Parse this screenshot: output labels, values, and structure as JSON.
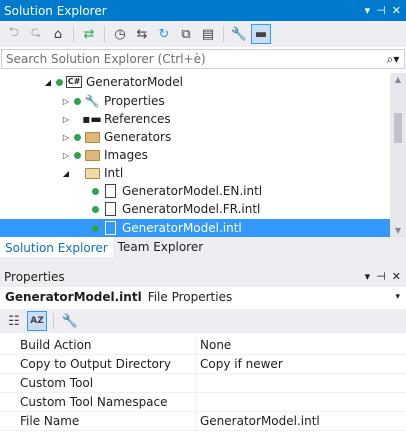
{
  "solution_explorer": {
    "title": "Solution Explorer",
    "title_buttons": [
      "▾",
      "⊣",
      "✕"
    ],
    "toolbar_icons": [
      "back-icon",
      "forward-icon",
      "home-icon",
      "sync-icon",
      "history-icon",
      "switch-views-icon",
      "refresh-icon",
      "collapse-all-icon",
      "show-all-files-icon",
      "properties-icon",
      "preview-icon"
    ],
    "search": {
      "placeholder": "Search Solution Explorer (Ctrl+è)",
      "dropdown": "⌕▾"
    },
    "tree": [
      {
        "label": "GeneratorModel",
        "type": "project"
      },
      {
        "label": "Properties",
        "type": "properties"
      },
      {
        "label": "References",
        "type": "references"
      },
      {
        "label": "Generators",
        "type": "folder"
      },
      {
        "label": "Images",
        "type": "folder"
      },
      {
        "label": "Intl",
        "type": "folder"
      },
      {
        "label": "GeneratorModel.EN.intl",
        "type": "file"
      },
      {
        "label": "GeneratorModel.FR.intl",
        "type": "file"
      },
      {
        "label": "GeneratorModel.intl",
        "type": "file",
        "selected": true
      }
    ],
    "tabs": {
      "solution_explorer": "Solution Explorer",
      "team_explorer": "Team Explorer"
    }
  },
  "properties": {
    "title": "Properties",
    "title_buttons": [
      "▾",
      "⊣",
      "✕"
    ],
    "object_name": "GeneratorModel.intl",
    "object_type": "File Properties",
    "toolbar_icons": [
      "categorized-icon",
      "alphabetical-icon",
      "property-pages-icon"
    ],
    "rows": [
      {
        "name": "Build Action",
        "value": "None"
      },
      {
        "name": "Copy to Output Directory",
        "value": "Copy if newer"
      },
      {
        "name": "Custom Tool",
        "value": ""
      },
      {
        "name": "Custom Tool Namespace",
        "value": ""
      },
      {
        "name": "File Name",
        "value": "GeneratorModel.intl"
      }
    ]
  },
  "colors": {
    "accent": "#007acc",
    "selection": "#3399ff",
    "chrome": "#eeeef2",
    "tab_active_text": "#0e70c0"
  }
}
